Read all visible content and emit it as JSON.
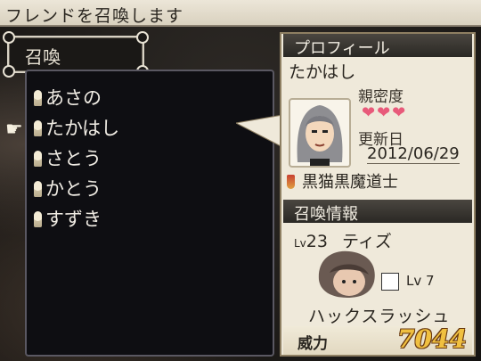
{
  "header": {
    "instruction": "フレンドを召喚します"
  },
  "summon_box": {
    "title": "召喚"
  },
  "friends": [
    {
      "name": "あさの"
    },
    {
      "name": "たかはし",
      "selected": true
    },
    {
      "name": "さとう"
    },
    {
      "name": "かとう"
    },
    {
      "name": "すずき"
    }
  ],
  "profile": {
    "header": "プロフィール",
    "name": "たかはし",
    "intimacy_label": "親密度",
    "intimacy_hearts": "❤❤❤",
    "updated_label": "更新日",
    "updated_date": "2012/06/29",
    "title": "黒猫黒魔道士"
  },
  "summon_info": {
    "header": "召喚情報",
    "monster_lv_prefix": "Lv",
    "monster_lv": "23",
    "monster_name": "ティズ",
    "skill_lv": "Lv 7",
    "skill_name": "ハックスラッシュ",
    "power_label": "威力",
    "power_value": "7044"
  },
  "colors": {
    "accent_gold": "#f0c040",
    "heart": "#e85a7a"
  }
}
